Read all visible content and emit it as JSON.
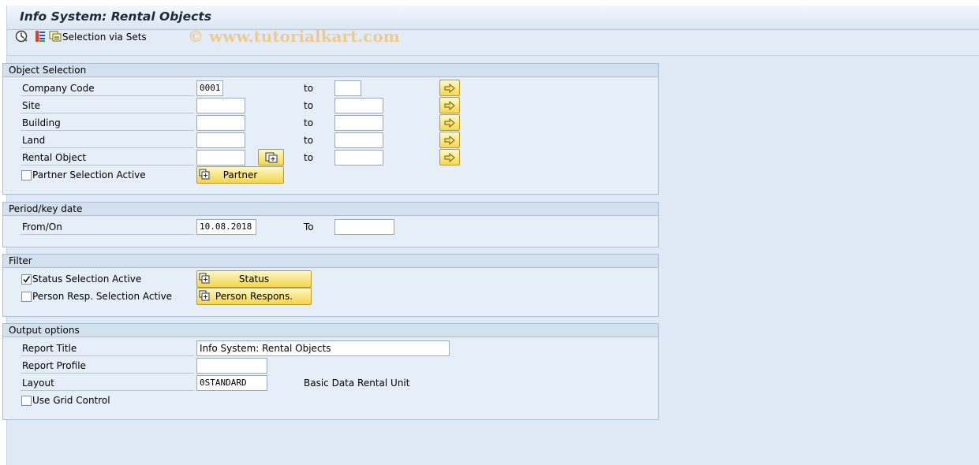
{
  "window": {
    "title": "Info System: Rental Objects"
  },
  "toolbar": {
    "execute_icon": "execute-icon",
    "get_variant_icon": "get-variant-icon",
    "selection_sets_icon": "selection-sets-icon",
    "selection_sets_label": "Selection via Sets"
  },
  "watermark": "© www.tutorialkart.com",
  "object_selection": {
    "title": "Object Selection",
    "rows": [
      {
        "label": "Company Code",
        "from_value": "0001",
        "to_label": "to",
        "to_value": ""
      },
      {
        "label": "Site",
        "from_value": "",
        "to_label": "to",
        "to_value": ""
      },
      {
        "label": "Building",
        "from_value": "",
        "to_label": "to",
        "to_value": ""
      },
      {
        "label": "Land",
        "from_value": "",
        "to_label": "to",
        "to_value": ""
      },
      {
        "label": "Rental Object",
        "from_value": "",
        "to_label": "to",
        "to_value": ""
      }
    ],
    "partner_checkbox": {
      "label": "Partner Selection Active",
      "checked": false
    },
    "partner_button": "Partner"
  },
  "period": {
    "title": "Period/key date",
    "from_label": "From/On",
    "from_value": "10.08.2018",
    "to_label": "To",
    "to_value": ""
  },
  "filter": {
    "title": "Filter",
    "status_checkbox": {
      "label": "Status Selection Active",
      "checked": true
    },
    "status_button": "Status",
    "person_checkbox": {
      "label": "Person Resp. Selection Active",
      "checked": false
    },
    "person_button": "Person Respons."
  },
  "output": {
    "title": "Output options",
    "report_title_label": "Report Title",
    "report_title_value": "Info System: Rental Objects",
    "report_profile_label": "Report Profile",
    "report_profile_value": "",
    "layout_label": "Layout",
    "layout_value": "0STANDARD",
    "layout_description": "Basic Data Rental Unit",
    "grid_checkbox": {
      "label": "Use Grid Control",
      "checked": false
    }
  },
  "colors": {
    "button_yellow": "#f3d54c",
    "panel_bg": "#dfe9f5",
    "group_head": "#d3e0ee"
  }
}
